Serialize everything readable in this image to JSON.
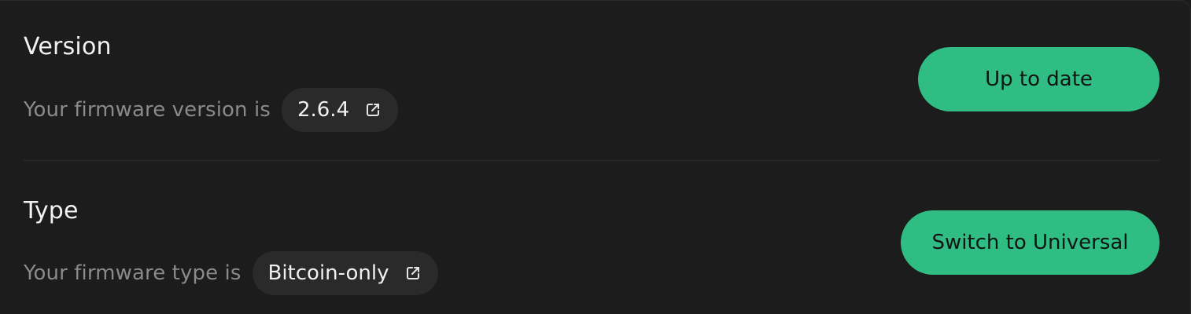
{
  "version": {
    "title": "Version",
    "label": "Your firmware version is",
    "chip_value": "2.6.4",
    "chip_icon": "external-link-icon",
    "button_label": "Up to date"
  },
  "type": {
    "title": "Type",
    "label": "Your firmware type is",
    "chip_value": "Bitcoin-only",
    "chip_icon": "external-link-icon",
    "button_label": "Switch to Universal"
  },
  "colors": {
    "background": "#1c1c1c",
    "chip_background": "#2a2a2a",
    "accent_green": "#2fbd84",
    "title_text": "#f2f2f2",
    "label_text": "#8a8a8a"
  }
}
